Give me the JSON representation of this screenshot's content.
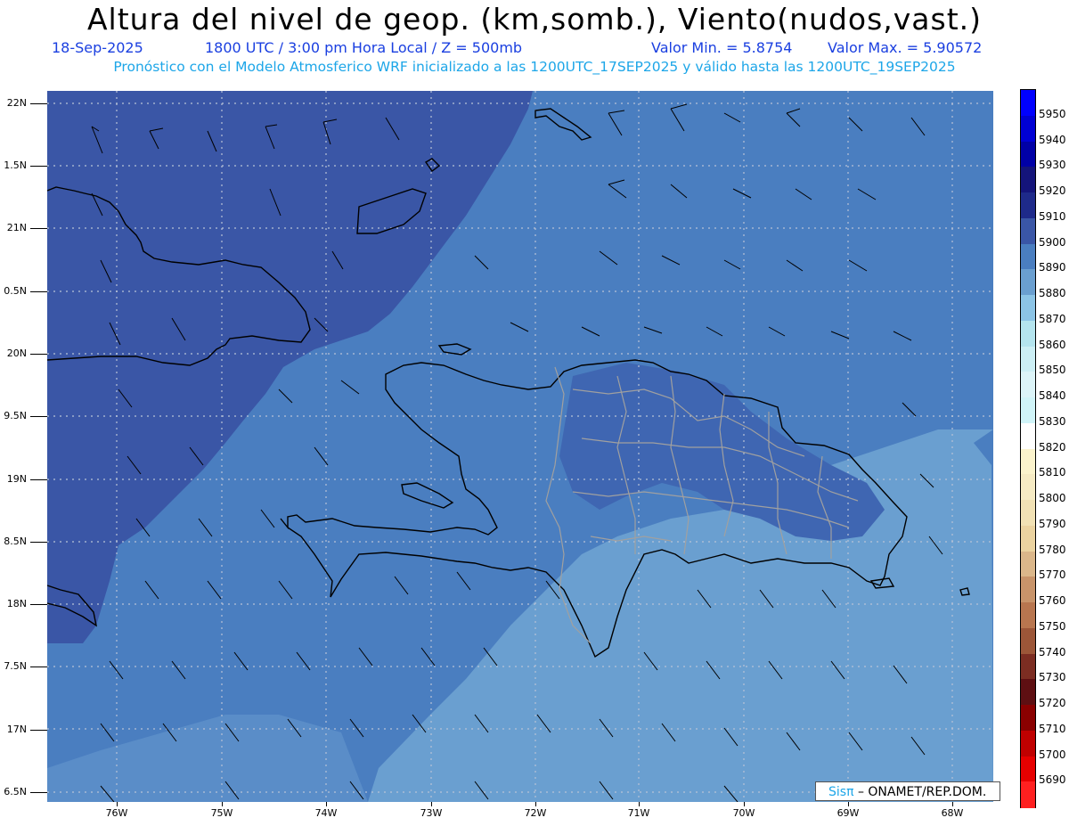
{
  "header": {
    "title": "Altura del nivel de geop. (km,somb.), Viento(nudos,vast.)",
    "date": "18-Sep-2025",
    "time": "1800 UTC / 3:00 pm Hora Local / Z = 500mb",
    "min": "Valor Min. = 5.8754",
    "max": "Valor Max. = 5.90572",
    "model_line": "Pronóstico con el Modelo Atmosferico WRF inicializado a las 1200UTC_17SEP2025 y válido hasta las  1200UTC_19SEP2025"
  },
  "axes": {
    "lat_labels": [
      "22N",
      "1.5N",
      "21N",
      "0.5N",
      "20N",
      "9.5N",
      "19N",
      "8.5N",
      "18N",
      "7.5N",
      "17N",
      "6.5N"
    ],
    "lon_labels": [
      "76W",
      "75W",
      "74W",
      "73W",
      "72W",
      "71W",
      "70W",
      "69W",
      "68W"
    ]
  },
  "colorbar": {
    "labels": [
      "5950",
      "5940",
      "5930",
      "5920",
      "5910",
      "5900",
      "5890",
      "5880",
      "5870",
      "5860",
      "5850",
      "5840",
      "5830",
      "5820",
      "5810",
      "5800",
      "5790",
      "5780",
      "5770",
      "5760",
      "5750",
      "5740",
      "5730",
      "5720",
      "5710",
      "5700",
      "5690"
    ],
    "colors": [
      "#0000ff",
      "#0000d4",
      "#0000a6",
      "#14147a",
      "#1e2a8a",
      "#3a56a6",
      "#4a7ec0",
      "#6a9fd0",
      "#8cc4e6",
      "#b4e4ee",
      "#cceff5",
      "#dcf4f8",
      "#d0f4f8",
      "#ffffff",
      "#fbf3cc",
      "#f6ebc4",
      "#f1e1b4",
      "#ebd3a0",
      "#dbb78a",
      "#c8946a",
      "#b8764f",
      "#9c5638",
      "#7c2d22",
      "#5e0f12",
      "#8a0000",
      "#c00000",
      "#e60000",
      "#ff2020"
    ]
  },
  "credit": {
    "brand": "Sisπ",
    "org": "– ONAMET/REP.DOM."
  },
  "map_colors": {
    "shade_5900": "#3a56a6",
    "shade_5890": "#4a7ec0",
    "shade_5880": "#6a9fd0",
    "coast": "#000000",
    "provinces": "#a0a0a0"
  }
}
